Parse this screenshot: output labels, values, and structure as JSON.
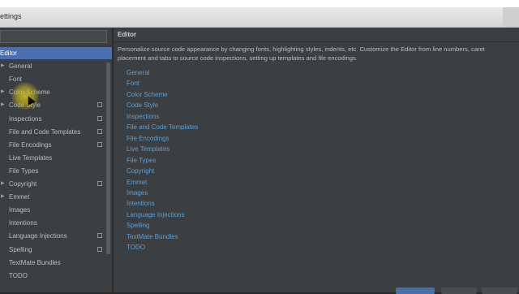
{
  "window": {
    "title": "ettings"
  },
  "sidebar": {
    "items": [
      {
        "label": "Editor",
        "selected": true,
        "indent": 0,
        "arrow": "",
        "project_icon": false
      },
      {
        "label": "General",
        "selected": false,
        "arrow": "▶",
        "project_icon": false
      },
      {
        "label": "Font",
        "selected": false,
        "arrow": "",
        "project_icon": false
      },
      {
        "label": "Color Scheme",
        "selected": false,
        "arrow": "▶",
        "project_icon": false
      },
      {
        "label": "Code Style",
        "selected": false,
        "arrow": "▶",
        "project_icon": true
      },
      {
        "label": "Inspections",
        "selected": false,
        "arrow": "",
        "project_icon": true
      },
      {
        "label": "File and Code Templates",
        "selected": false,
        "arrow": "",
        "project_icon": true
      },
      {
        "label": "File Encodings",
        "selected": false,
        "arrow": "",
        "project_icon": true
      },
      {
        "label": "Live Templates",
        "selected": false,
        "arrow": "",
        "project_icon": false
      },
      {
        "label": "File Types",
        "selected": false,
        "arrow": "",
        "project_icon": false
      },
      {
        "label": "Copyright",
        "selected": false,
        "arrow": "▶",
        "project_icon": true
      },
      {
        "label": "Emmet",
        "selected": false,
        "arrow": "▶",
        "project_icon": false
      },
      {
        "label": "Images",
        "selected": false,
        "arrow": "",
        "project_icon": false
      },
      {
        "label": "Intentions",
        "selected": false,
        "arrow": "",
        "project_icon": false
      },
      {
        "label": "Language Injections",
        "selected": false,
        "arrow": "",
        "project_icon": true
      },
      {
        "label": "Spelling",
        "selected": false,
        "arrow": "",
        "project_icon": true
      },
      {
        "label": "TextMate Bundles",
        "selected": false,
        "arrow": "",
        "project_icon": false
      },
      {
        "label": "TODO",
        "selected": false,
        "arrow": "",
        "project_icon": false
      }
    ]
  },
  "main": {
    "breadcrumb": "Editor",
    "description": "Personalize source code appearance by changing fonts, highlighting styles, indents, etc. Customize the Editor from line numbers, caret placement and tabs to source code inspections, setting up templates and file encodings.",
    "links": [
      "General",
      "Font",
      "Color Scheme",
      "Code Style",
      "Inspections",
      "File and Code Templates",
      "File Encodings",
      "Live Templates",
      "File Types",
      "Copyright",
      "Emmet",
      "Images",
      "Intentions",
      "Language Injections",
      "Spelling",
      "TextMate Bundles",
      "TODO"
    ]
  },
  "colors": {
    "selection": "#4b6eaf",
    "link": "#5a9fd6",
    "panel": "#3c3f41",
    "text": "#bbbbbb"
  }
}
